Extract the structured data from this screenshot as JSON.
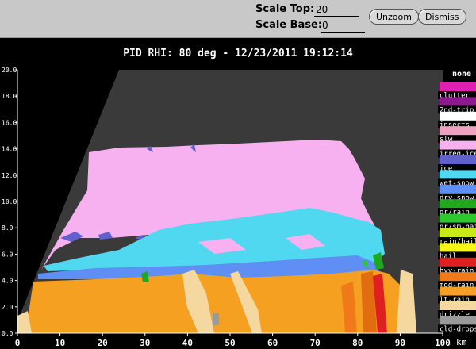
{
  "toolbar": {
    "scale_top_label": "Scale Top:",
    "scale_top_value": "20",
    "scale_base_label": "Scale Base:",
    "scale_base_value": "0",
    "unzoom_label": "Unzoom",
    "dismiss_label": "Dismiss"
  },
  "plot": {
    "title": "PID  RHI: 80 deg  -  12/23/2011 19:12:14",
    "y_ticks": [
      "0.0",
      "2.0",
      "4.0",
      "6.0",
      "8.0",
      "10.0",
      "12.0",
      "14.0",
      "16.0",
      "18.0",
      "20.0"
    ],
    "x_ticks": [
      "0",
      "10",
      "20",
      "30",
      "40",
      "50",
      "60",
      "70",
      "80",
      "90",
      "100"
    ],
    "x_unit": "km",
    "corner_value": "2"
  },
  "legend": {
    "header": "none",
    "entries": [
      {
        "label": "clutter",
        "color": "#e020b0"
      },
      {
        "label": "2nd-trip",
        "color": "#8c1a8c"
      },
      {
        "label": "insects",
        "color": "#ffffff"
      },
      {
        "label": "slw",
        "color": "#f0a0c0"
      },
      {
        "label": "irreg-ice",
        "color": "#f7b0f0"
      },
      {
        "label": "ice",
        "color": "#6060d0"
      },
      {
        "label": "wet-snow",
        "color": "#50d8f0"
      },
      {
        "label": "dry-snow",
        "color": "#5f8ef5"
      },
      {
        "label": "gr/rain",
        "color": "#20a820"
      },
      {
        "label": "gr/sm-hail",
        "color": "#2ec82e"
      },
      {
        "label": "rain/hail",
        "color": "#c8e81a"
      },
      {
        "label": "hail",
        "color": "#f5f51a"
      },
      {
        "label": "hvy-rain",
        "color": "#e02020"
      },
      {
        "label": "mod-rain",
        "color": "#f07a1a"
      },
      {
        "label": "lt-rain",
        "color": "#f5a020"
      },
      {
        "label": "drizzle",
        "color": "#f5d8a0"
      },
      {
        "label": "cld-drops",
        "color": "#9a9a9a"
      }
    ]
  },
  "colors": {
    "background": "#3a3a3a",
    "outside": "#000000",
    "axis": "#ffffff",
    "tick_text": "#ffffff"
  }
}
